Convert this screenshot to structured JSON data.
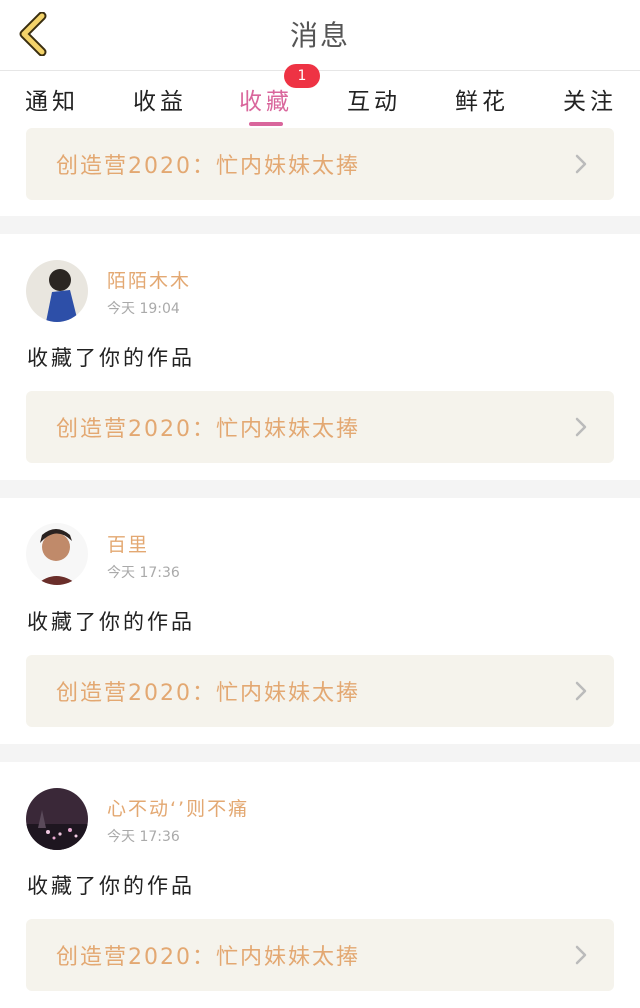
{
  "header": {
    "title": "消息",
    "back_icon": "chevron-left-icon"
  },
  "tabs": [
    {
      "label": "通知"
    },
    {
      "label": "收益"
    },
    {
      "label": "收藏",
      "active": true,
      "badge": "1"
    },
    {
      "label": "互动"
    },
    {
      "label": "鲜花"
    },
    {
      "label": "关注"
    }
  ],
  "colors": {
    "accent": "#d9669c",
    "link": "#e3a872",
    "badge": "#ee3344",
    "card_bg": "#f5f3ec"
  },
  "top_card": {
    "link_text": "创造营2020：忙内妹妹太捧"
  },
  "items": [
    {
      "name": "陌陌木木",
      "time": "今天 19:04",
      "action": "收藏了你的作品",
      "link_text": "创造营2020：忙内妹妹太捧"
    },
    {
      "name": "百里",
      "time": "今天 17:36",
      "action": "收藏了你的作品",
      "link_text": "创造营2020：忙内妹妹太捧"
    },
    {
      "name": "心不动‘’则不痛",
      "time": "今天 17:36",
      "action": "收藏了你的作品",
      "link_text": "创造营2020：忙内妹妹太捧"
    }
  ]
}
